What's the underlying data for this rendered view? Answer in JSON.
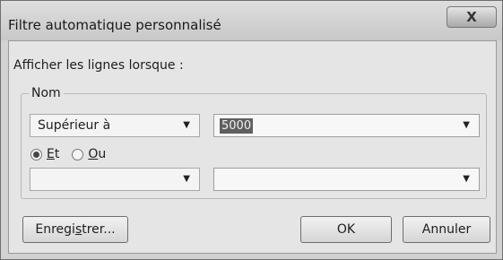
{
  "window": {
    "title": "Filtre automatique personnalisé",
    "close_glyph": "X"
  },
  "prompt": "Afficher les lignes lorsque :",
  "group": {
    "legend": "Nom",
    "row1": {
      "operator": "Supérieur à",
      "value": "5000"
    },
    "logic": {
      "and": {
        "prefix": "",
        "underlined": "E",
        "suffix": "t",
        "checked": true
      },
      "or": {
        "prefix": "",
        "underlined": "O",
        "suffix": "u",
        "checked": false
      }
    },
    "row2": {
      "operator": "",
      "value": ""
    }
  },
  "buttons": {
    "save": {
      "prefix": "Enregi",
      "underlined": "s",
      "suffix": "trer..."
    },
    "ok": "OK",
    "cancel": "Annuler"
  },
  "icons": {
    "dropdown": "chevron-down-icon",
    "close": "close-icon"
  }
}
